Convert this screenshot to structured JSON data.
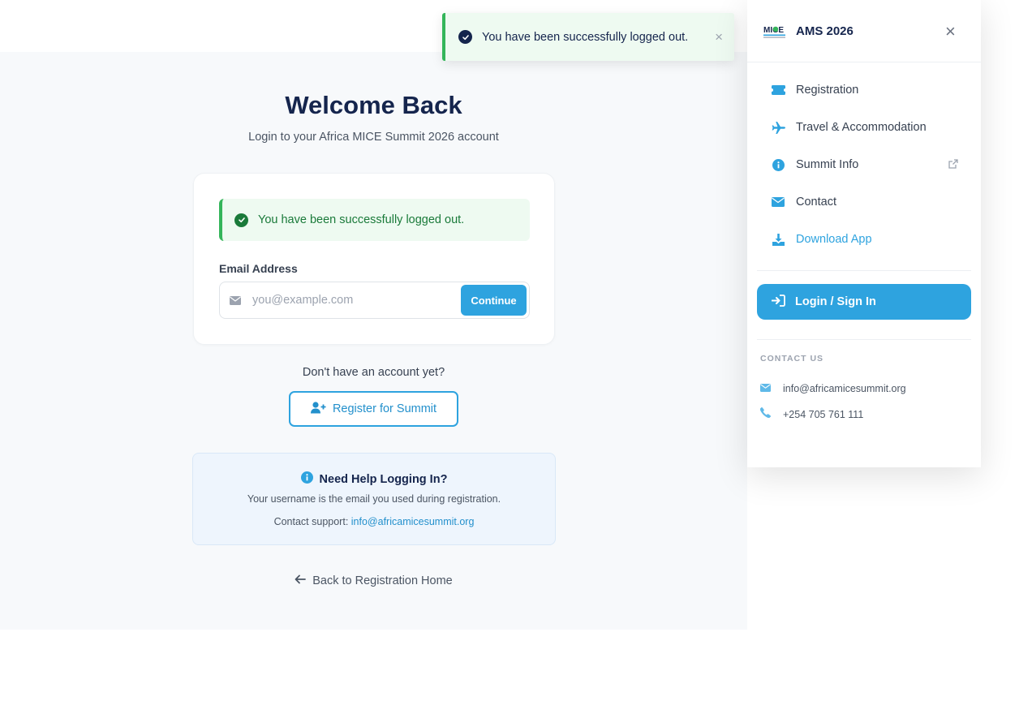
{
  "main": {
    "title": "Welcome Back",
    "subtitle": "Login to your Africa MICE Summit 2026 account",
    "alert_text": "You have been successfully logged out.",
    "email_label": "Email Address",
    "email_placeholder": "you@example.com",
    "email_value": "",
    "continue_label": "Continue",
    "no_account_text": "Don't have an account yet?",
    "register_label": "Register for Summit",
    "help": {
      "heading": "Need Help Logging In?",
      "line1": "Your username is the email you used during registration.",
      "line2_prefix": "Contact support: ",
      "line2_link": "info@africamicesummit.org"
    },
    "back_label": "Back to Registration Home"
  },
  "toast": {
    "text": "You have been successfully logged out.",
    "close": "×"
  },
  "drawer": {
    "brand": "AMS 2026",
    "logo_text": "MICE",
    "close": "×",
    "nav": [
      {
        "label": "Registration",
        "icon": "ticket-icon"
      },
      {
        "label": "Travel & Accommodation",
        "icon": "plane-icon"
      },
      {
        "label": "Summit Info",
        "icon": "info-icon",
        "external": true
      },
      {
        "label": "Contact",
        "icon": "envelope-icon"
      },
      {
        "label": "Download App",
        "icon": "download-icon"
      }
    ],
    "login_label": "Login / Sign In",
    "contact_heading": "CONTACT US",
    "contact_email": "info@africamicesummit.org",
    "contact_phone": "+254 705 761 111"
  },
  "colors": {
    "accent": "#2ea3df",
    "navy": "#15254d",
    "success": "#34b55a"
  }
}
